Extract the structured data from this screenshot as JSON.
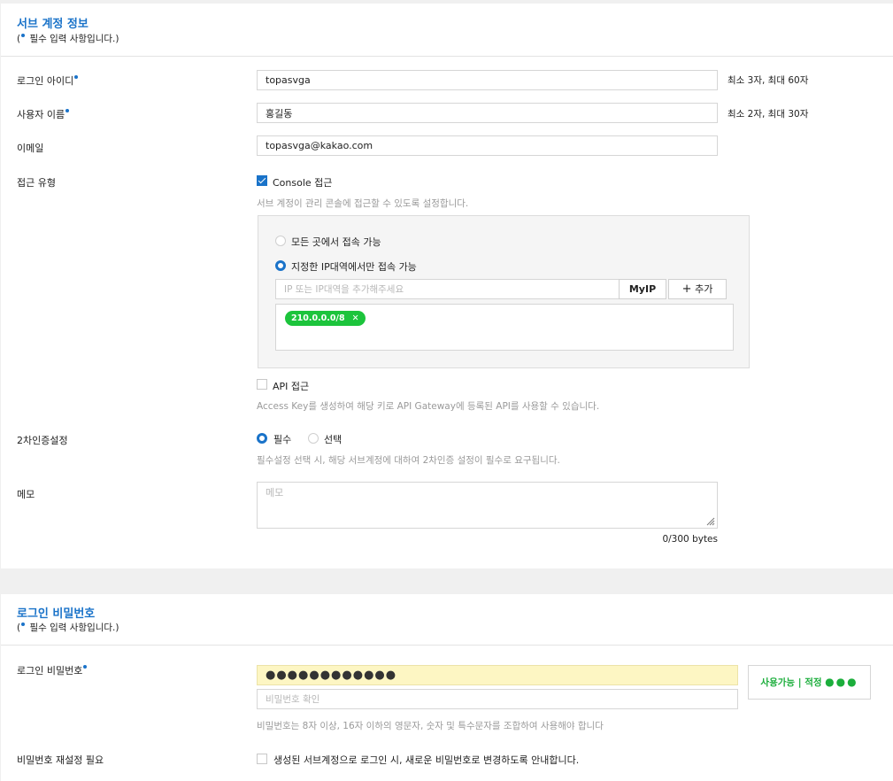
{
  "sub_account": {
    "title": "서브 계정 정보",
    "required_note_open": "(",
    "required_note_text": " 필수 입력 사항입니다.)",
    "login_id": {
      "label": "로그인 아이디",
      "value": "topasvga",
      "note": "최소 3자, 최대 60자"
    },
    "user_name": {
      "label": "사용자 이름",
      "value": "홍길동",
      "note": "최소 2자, 최대 30자"
    },
    "email": {
      "label": "이메일",
      "value": "topasvga@kakao.com"
    },
    "access_type": {
      "label": "접근 유형",
      "console_label": "Console 접근",
      "console_hint": "서브 계정이 관리 콘솔에 접근할 수 있도록 설정합니다.",
      "from_anywhere": "모든 곳에서 접속 가능",
      "from_ip_only": "지정한 IP대역에서만 접속 가능",
      "ip_placeholder": "IP 또는 IP대역을 추가해주세요",
      "myip_button": "MyIP",
      "add_button": "추가",
      "ip_tags": [
        "210.0.0.0/8"
      ],
      "api_label": "API 접근",
      "api_hint": "Access Key를 생성하여 해당 키로 API Gateway에 등록된 API를 사용할 수 있습니다."
    },
    "two_factor": {
      "label": "2차인증설정",
      "required_option": "필수",
      "optional_option": "선택",
      "hint": "필수설정 선택 시, 해당 서브계정에 대하여 2차인증 설정이 필수로 요구됩니다."
    },
    "memo": {
      "label": "메모",
      "placeholder": "메모",
      "counter": "0/300 bytes"
    }
  },
  "login_password": {
    "title": "로그인 비밀번호",
    "required_note_open": "(",
    "required_note_text": " 필수 입력 사항입니다.)",
    "password_label": "로그인 비밀번호",
    "password_value": "●●●●●●●●●●●●",
    "confirm_placeholder": "비밀번호 확인",
    "status_text": "사용가능 | 적정",
    "status_dots": "●●●",
    "hint": "비밀번호는 8자 이상, 16자 이하의 영문자, 숫자 및 특수문자를 조합하여 사용해야 합니다",
    "reset_label": "비밀번호 재설정 필요",
    "reset_option": "생성된 서브계정으로 로그인 시, 새로운 비밀번호로 변경하도록 안내합니다."
  },
  "colors": {
    "accent": "#1a73c9",
    "success": "#1cc43c"
  }
}
